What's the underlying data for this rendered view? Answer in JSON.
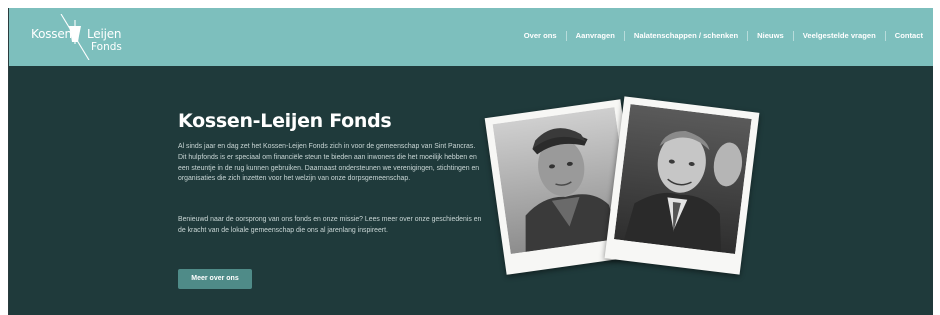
{
  "brand": {
    "line1": "Kossen",
    "line2": "Leijen",
    "line3": "Fonds"
  },
  "nav": {
    "items": [
      {
        "label": "Over ons"
      },
      {
        "label": "Aanvragen"
      },
      {
        "label": "Nalatenschappen / schenken"
      },
      {
        "label": "Nieuws"
      },
      {
        "label": "Veelgestelde vragen"
      },
      {
        "label": "Contact"
      }
    ]
  },
  "hero": {
    "title": "Kossen-Leijen Fonds",
    "paragraph1": "Al sinds jaar en dag zet het Kossen-Leijen Fonds zich in voor de gemeenschap van Sint Pancras. Dit hulpfonds is er speciaal om financiële steun te bieden aan inwoners die het moeilijk hebben en een steuntje in de rug kunnen gebruiken. Daarnaast ondersteunen we verenigingen, stichtingen en organisaties die zich inzetten voor het welzijn van onze dorpsgemeenschap.",
    "paragraph2": "Benieuwd naar de oorsprong van ons fonds en onze missie? Lees meer over onze geschiedenis en de kracht van de lokale gemeenschap die ons al jarenlang inspireert.",
    "button": "Meer over ons"
  },
  "colors": {
    "header_bg": "#7dbfbd",
    "main_bg": "#1f3a3b",
    "button_bg": "#4f8b88",
    "text_light": "#c9d6d5"
  }
}
